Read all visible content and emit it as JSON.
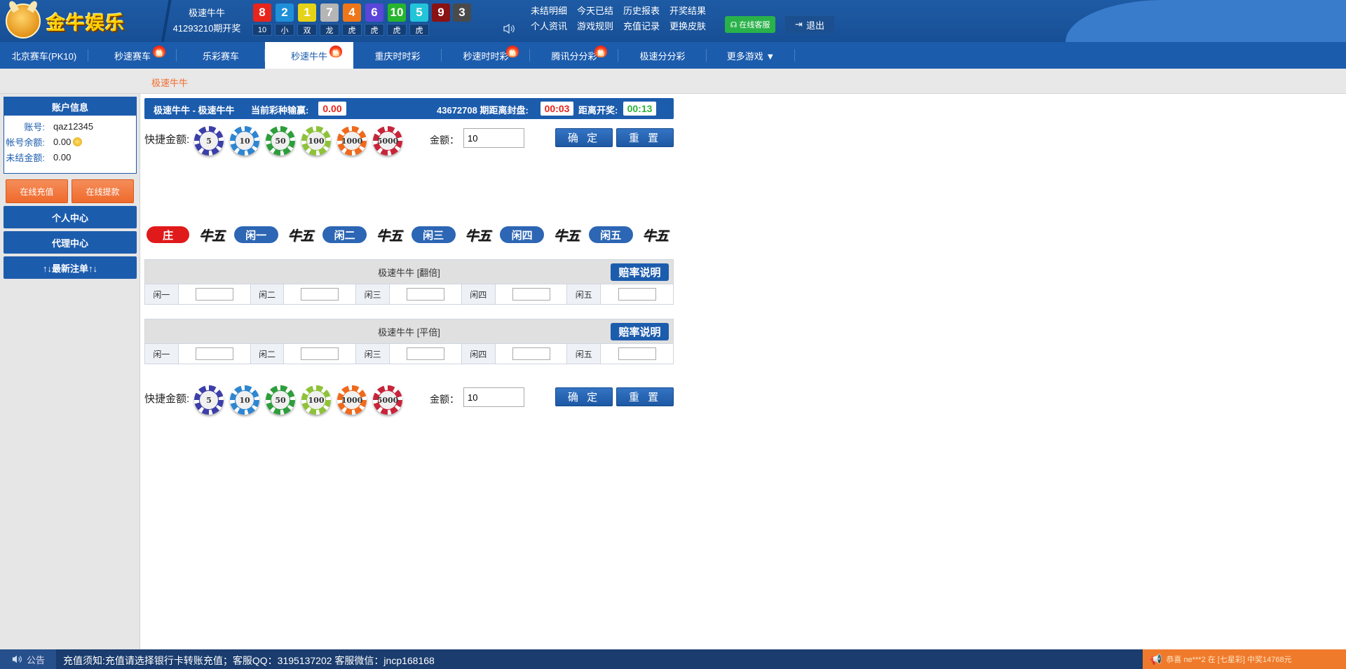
{
  "header": {
    "logo_text": "金牛娱乐",
    "game_name": "极速牛牛",
    "period_text": "41293210期开奖",
    "balls": [
      {
        "num": "8",
        "color": "#e8251b",
        "tag": "10"
      },
      {
        "num": "2",
        "color": "#1f8fd9",
        "tag": "小"
      },
      {
        "num": "1",
        "color": "#e6d317",
        "tag": "双"
      },
      {
        "num": "7",
        "color": "#b5b5b5",
        "tag": "龙"
      },
      {
        "num": "4",
        "color": "#f0761a",
        "tag": "虎"
      },
      {
        "num": "6",
        "color": "#5a46d8",
        "tag": "虎"
      },
      {
        "num": "10",
        "color": "#27b42e",
        "tag": "虎"
      },
      {
        "num": "5",
        "color": "#22c4d8",
        "tag": "虎"
      },
      {
        "num": "9",
        "color": "#8a1212",
        "tag": ""
      },
      {
        "num": "3",
        "color": "#4a4a4a",
        "tag": ""
      }
    ],
    "links": [
      "未结明细",
      "今天已结",
      "历史报表",
      "开奖结果",
      "个人资讯",
      "游戏规则",
      "充值记录",
      "更换皮肤"
    ],
    "service_label": "在线客服",
    "logout_label": "退出"
  },
  "nav": [
    {
      "label": "北京赛车(PK10)",
      "hot": false,
      "active": false
    },
    {
      "label": "秒速赛车",
      "hot": true,
      "active": false
    },
    {
      "label": "乐彩赛车",
      "hot": false,
      "active": false
    },
    {
      "label": "秒速牛牛",
      "hot": true,
      "active": true
    },
    {
      "label": "重庆时时彩",
      "hot": false,
      "active": false
    },
    {
      "label": "秒速时时彩",
      "hot": true,
      "active": false
    },
    {
      "label": "腾讯分分彩",
      "hot": true,
      "active": false
    },
    {
      "label": "极速分分彩",
      "hot": false,
      "active": false
    },
    {
      "label": "更多游戏  ▼",
      "hot": false,
      "active": false
    }
  ],
  "hot_badge": "熱",
  "breadcrumb": "极速牛牛",
  "sidebar": {
    "account_title": "账户信息",
    "account_label": "账号:",
    "account_value": "qaz12345",
    "balance_label": "帐号余额:",
    "balance_value": "0.00",
    "unsettled_label": "未结金额:",
    "unsettled_value": "0.00",
    "recharge_label": "在线充值",
    "withdraw_label": "在线提款",
    "personal_center": "个人中心",
    "agent_center": "代理中心",
    "latest_bets": "↑↓最新注单↑↓"
  },
  "status": {
    "title": "极速牛牛  -  极速牛牛",
    "winloss_label": "当前彩种输赢:",
    "winloss_value": "0.00",
    "period_label": "43672708 期距离封盘:",
    "close_time": "00:03",
    "draw_label": "距离开奖:",
    "draw_time": "00:13"
  },
  "quick": {
    "label": "快捷金额:",
    "chips": [
      {
        "value": "5",
        "color": "#3c3fa8"
      },
      {
        "value": "10",
        "color": "#2e86d1"
      },
      {
        "value": "50",
        "color": "#2e9e3c"
      },
      {
        "value": "100",
        "color": "#8ec23a"
      },
      {
        "value": "1000",
        "color": "#ef6a1c"
      },
      {
        "value": "5000",
        "color": "#c8243a"
      }
    ],
    "amount_label": "金额：",
    "amount_value": "10",
    "confirm_label": "确 定",
    "reset_label": "重 置"
  },
  "players": [
    {
      "label": "庄",
      "color": "#e01a1a",
      "result": "牛五"
    },
    {
      "label": "闲一",
      "color": "#2c66b4",
      "result": "牛五"
    },
    {
      "label": "闲二",
      "color": "#2c66b4",
      "result": "牛五"
    },
    {
      "label": "闲三",
      "color": "#2c66b4",
      "result": "牛五"
    },
    {
      "label": "闲四",
      "color": "#2c66b4",
      "result": "牛五"
    },
    {
      "label": "闲五",
      "color": "#2c66b4",
      "result": "牛五"
    }
  ],
  "tables": [
    {
      "title": "极速牛牛 [翻倍]",
      "odds_label": "赔率说明",
      "cols": [
        "闲一",
        "闲二",
        "闲三",
        "闲四",
        "闲五"
      ]
    },
    {
      "title": "极速牛牛 [平倍]",
      "odds_label": "赔率说明",
      "cols": [
        "闲一",
        "闲二",
        "闲三",
        "闲四",
        "闲五"
      ]
    }
  ],
  "footer": {
    "notice_label": "公告",
    "notice_text": "充值须知:充值请选择银行卡转账充值；客服QQ：3195137202 客服微信：jncp168168",
    "winner_text": "恭喜 ne***2 在 [七星彩] 中奖14768元"
  }
}
